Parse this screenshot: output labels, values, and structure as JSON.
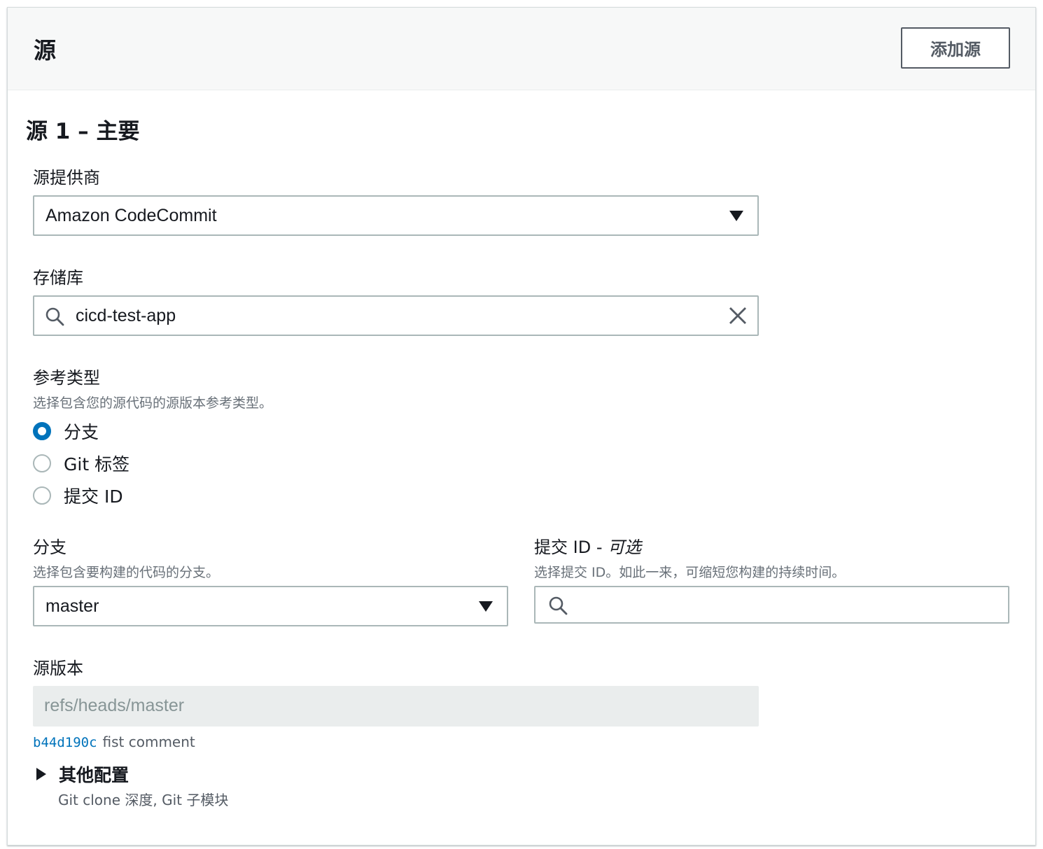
{
  "header": {
    "title": "源",
    "add_source_button": "添加源"
  },
  "section": {
    "title": "源 1 – 主要"
  },
  "source_provider": {
    "label": "源提供商",
    "selected": "Amazon CodeCommit"
  },
  "repository": {
    "label": "存储库",
    "value": "cicd-test-app"
  },
  "reference_type": {
    "label": "参考类型",
    "description": "选择包含您的源代码的源版本参考类型。",
    "options": [
      {
        "label": "分支",
        "checked": true
      },
      {
        "label": "Git 标签",
        "checked": false
      },
      {
        "label": "提交 ID",
        "checked": false
      }
    ]
  },
  "branch": {
    "label": "分支",
    "description": "选择包含要构建的代码的分支。",
    "selected": "master"
  },
  "commit_id": {
    "label": "提交 ID - ",
    "label_optional": "可选",
    "description": "选择提交 ID。如此一来，可缩短您构建的持续时间。",
    "value": ""
  },
  "source_version": {
    "label": "源版本",
    "value": "refs/heads/master",
    "commit_hash": "b44d190c",
    "commit_message": "fist comment"
  },
  "additional_config": {
    "label": "其他配置",
    "description": "Git clone 深度, Git 子模块"
  },
  "colors": {
    "accent": "#0073bb",
    "border": "#aab7b8",
    "disabled_bg": "#eaeded"
  }
}
